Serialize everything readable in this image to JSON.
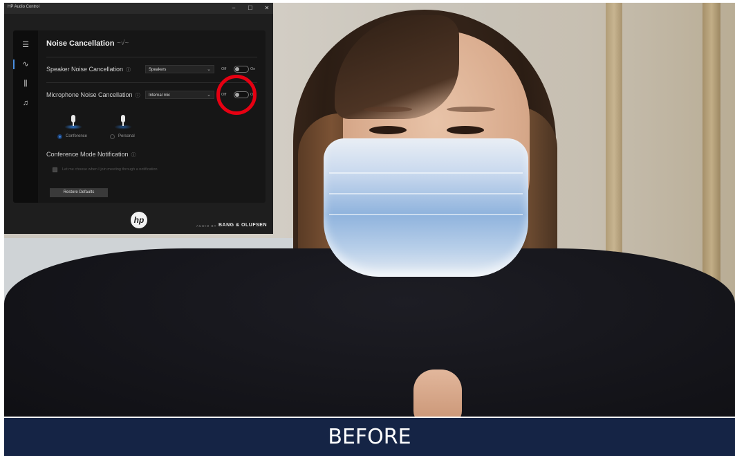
{
  "app": {
    "window_title": "HP Audio Control",
    "controls": {
      "minimize": "–",
      "maximize": "☐",
      "close": "✕"
    },
    "section_title": "Noise Cancellation",
    "speaker": {
      "label": "Speaker Noise Cancellation",
      "selected": "Speakers",
      "off_label": "Off",
      "on_label": "On",
      "enabled": false
    },
    "microphone": {
      "label": "Microphone Noise Cancellation",
      "selected": "Internal mic",
      "off_label": "Off",
      "on_label": "On",
      "enabled": false
    },
    "modes": [
      {
        "label": "Conference",
        "selected": true
      },
      {
        "label": "Personal",
        "selected": false
      }
    ],
    "notification": {
      "label": "Conference Mode Notification",
      "checkbox_label": "Let me choose when I join meeting through a notification",
      "checked": false
    },
    "restore_label": "Restore Defaults",
    "brand": {
      "logo": "hp",
      "prefix": "AUDIO BY",
      "name": "BANG & OLUFSEN"
    },
    "accent_color": "#4a90e2",
    "annotation_color": "#e60012"
  },
  "caption": {
    "text": "BEFORE",
    "background": "#152445"
  }
}
